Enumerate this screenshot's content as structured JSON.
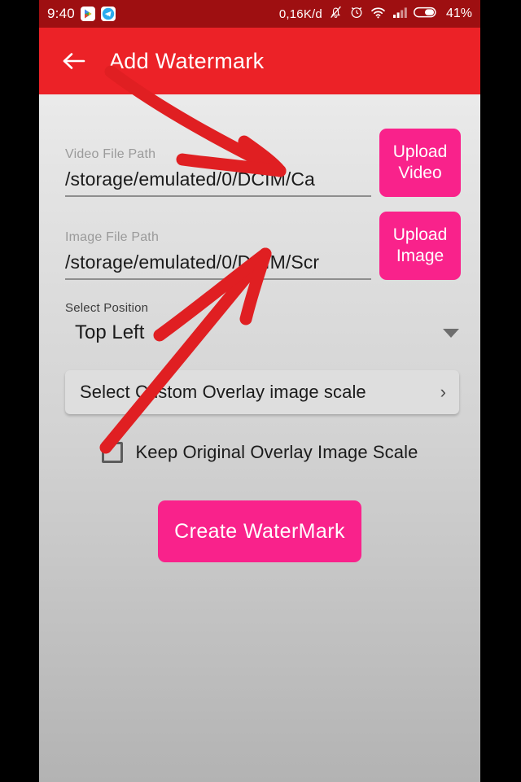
{
  "statusbar": {
    "time": "9:40",
    "data_rate": "0,16K/d",
    "battery_percent": "41%",
    "icons": [
      "play-store-icon",
      "telegram-icon",
      "notifications-muted-icon",
      "alarm-clock-icon",
      "wifi-icon",
      "cellular-signal-icon",
      "battery-icon"
    ]
  },
  "appbar": {
    "back_label": "back-arrow-icon",
    "title": "Add Watermark"
  },
  "form": {
    "video": {
      "label": "Video File Path",
      "value": "/storage/emulated/0/DCIM/Ca",
      "button_line1": "Upload",
      "button_line2": "Video"
    },
    "image": {
      "label": "Image File Path",
      "value": "/storage/emulated/0/DCIM/Scr",
      "button_line1": "Upload",
      "button_line2": "Image"
    },
    "position": {
      "label": "Select Position",
      "value": "Top Left"
    },
    "overlay_scale": {
      "label": "Select Custom Overlay image scale",
      "chevron": "chevron-right-icon"
    },
    "keep_scale": {
      "label": "Keep Original Overlay Image Scale",
      "checked": false
    },
    "submit": {
      "label": "Create WaterMark"
    }
  },
  "colors": {
    "statusbar_red": "#9e0f11",
    "appbar_red": "#ec2227",
    "accent_pink": "#f9228b",
    "annotation_red": "#e01f22"
  }
}
